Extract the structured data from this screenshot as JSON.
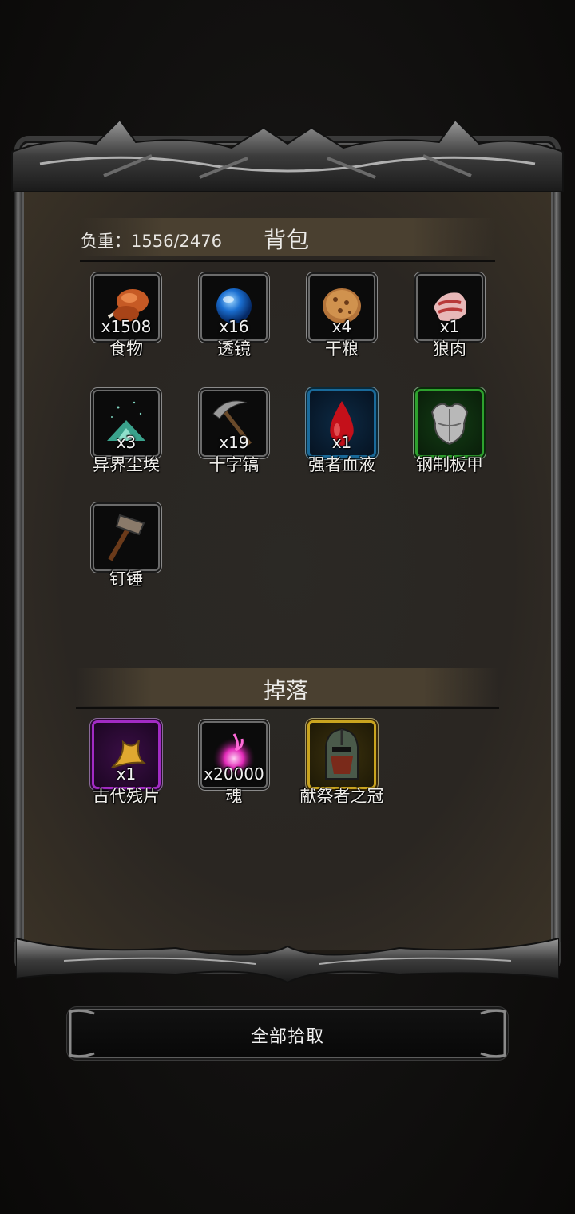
{
  "backpack": {
    "weight_label": "负重：1556/2476",
    "title": "背包",
    "items": [
      {
        "name": "食物",
        "count": "x1508",
        "icon": "food-meat-icon"
      },
      {
        "name": "透镜",
        "count": "x16",
        "icon": "lens-orb-icon"
      },
      {
        "name": "干粮",
        "count": "x4",
        "icon": "ration-bread-icon"
      },
      {
        "name": "狼肉",
        "count": "x1",
        "icon": "wolf-meat-icon"
      },
      {
        "name": "异界尘埃",
        "count": "x3",
        "icon": "otherworld-dust-icon"
      },
      {
        "name": "十字镐",
        "count": "x19",
        "icon": "pickaxe-icon"
      },
      {
        "name": "强者血液",
        "count": "x1",
        "icon": "blood-drop-icon"
      },
      {
        "name": "钢制板甲",
        "count": "",
        "icon": "steel-plate-armor-icon"
      },
      {
        "name": "钉锤",
        "count": "",
        "icon": "hammer-icon"
      }
    ]
  },
  "drops": {
    "title": "掉落",
    "items": [
      {
        "name": "古代残片",
        "count": "x1",
        "icon": "ancient-fragment-icon"
      },
      {
        "name": "魂",
        "count": "x20000",
        "icon": "soul-flame-icon"
      },
      {
        "name": "献祭者之冠",
        "count": "",
        "icon": "sacrificer-helm-icon"
      }
    ]
  },
  "actions": {
    "pickup_all": "全部拾取"
  },
  "colors": {
    "rarity_blue": "#1a6a9a",
    "rarity_green": "#2ea12e",
    "rarity_purple": "#a22bc4",
    "rarity_gold": "#c9a41f"
  }
}
